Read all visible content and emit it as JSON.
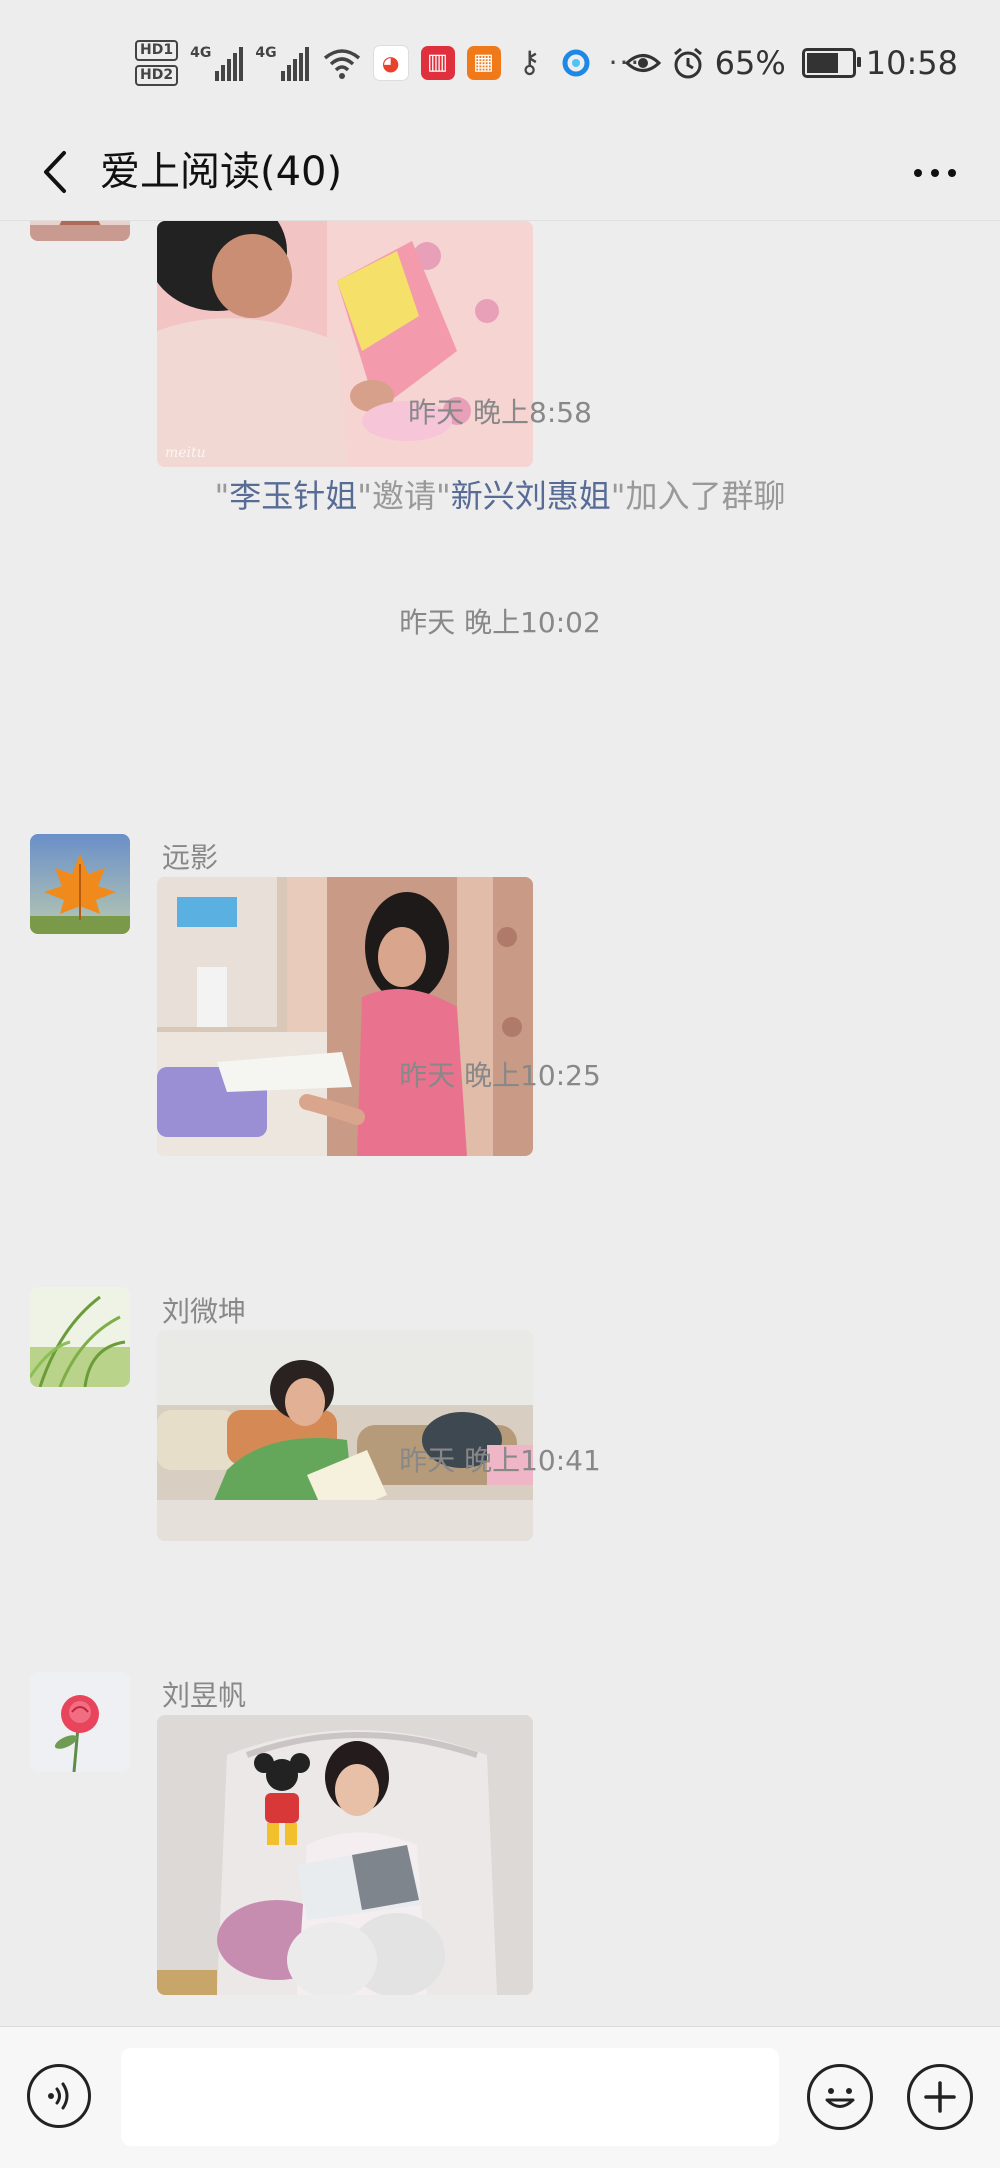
{
  "status_bar": {
    "hd1": "HD1",
    "hd2": "HD2",
    "net1": "4G",
    "net2": "4G",
    "app_icons": [
      "weibo-icon",
      "book-icon",
      "scan-icon",
      "key-icon",
      "browser-icon"
    ],
    "overflow": "···",
    "battery": "65%",
    "time": "10:58"
  },
  "header": {
    "title": "爱上阅读(40)"
  },
  "chat": {
    "timestamps": [
      "昨天 晚上8:58",
      "昨天 晚上10:02",
      "昨天 晚上10:25",
      "昨天 晚上10:41"
    ],
    "system_message": {
      "q1": "\"",
      "inviter": "李玉针姐",
      "mid1": "\"邀请\"",
      "invitee": "新兴刘惠姐",
      "tail": "\"加入了群聊"
    },
    "messages": [
      {
        "sender": "",
        "image": "child-reading-picture-book-photo",
        "watermark": "meitu"
      },
      {
        "sender": "远影",
        "avatar": "maple-leaf-avatar",
        "image": "girl-reading-at-desk-photo"
      },
      {
        "sender": "刘微坤",
        "avatar": "grass-avatar",
        "image": "girl-reading-on-sofa-photo"
      },
      {
        "sender": "刘昱帆",
        "avatar": "rose-avatar",
        "image": "girl-reading-on-bed-photo"
      }
    ]
  },
  "input_bar": {
    "value": "",
    "placeholder": ""
  },
  "colors": {
    "background": "#ededed",
    "link_name": "#576b95",
    "timestamp": "#888888"
  }
}
